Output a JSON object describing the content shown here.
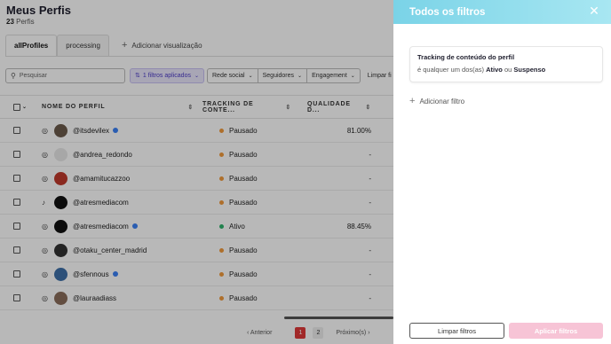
{
  "page": {
    "title": "Meus Perfis",
    "count": "23",
    "count_label": "Perfis"
  },
  "tabs": [
    {
      "label": "allProfiles",
      "active": true
    },
    {
      "label": "processing",
      "active": false
    }
  ],
  "add_view_label": "Adicionar visualização",
  "filters": {
    "search_placeholder": "Pesquisar",
    "applied_label": "1 filtros aplicados",
    "social_network_label": "Rede social",
    "followers_label": "Seguidores",
    "engagement_label": "Engagement",
    "clear_label": "Limpar fi"
  },
  "table": {
    "headers": {
      "name": "NOME DO PERFIL",
      "tracking": "TRACKING DE CONTE...",
      "quality": "QUALIDADE D..."
    },
    "rows": [
      {
        "network": "instagram",
        "handle": "@itsdevilex",
        "verified": true,
        "status": "Pausado",
        "quality": "81.00%",
        "avatar_color": "#6b5b4b"
      },
      {
        "network": "instagram",
        "handle": "@andrea_redondo",
        "verified": false,
        "status": "Pausado",
        "quality": "-",
        "avatar_color": "#e8e8e8"
      },
      {
        "network": "instagram",
        "handle": "@amamitucazzoo",
        "verified": false,
        "status": "Pausado",
        "quality": "-",
        "avatar_color": "#c0392b"
      },
      {
        "network": "tiktok",
        "handle": "@atresmediacom",
        "verified": false,
        "status": "Pausado",
        "quality": "-",
        "avatar_color": "#111111"
      },
      {
        "network": "instagram",
        "handle": "@atresmediacom",
        "verified": true,
        "status": "Ativo",
        "quality": "88.45%",
        "avatar_color": "#111111"
      },
      {
        "network": "instagram",
        "handle": "@otaku_center_madrid",
        "verified": false,
        "status": "Pausado",
        "quality": "-",
        "avatar_color": "#333333"
      },
      {
        "network": "instagram",
        "handle": "@sfennous",
        "verified": true,
        "status": "Pausado",
        "quality": "-",
        "avatar_color": "#3d6fa8"
      },
      {
        "network": "instagram",
        "handle": "@lauraadiass",
        "verified": false,
        "status": "Pausado",
        "quality": "-",
        "avatar_color": "#8a6d5a"
      }
    ]
  },
  "pagination": {
    "prev_label": "Anterior",
    "pages": [
      "1",
      "2"
    ],
    "current": "1",
    "next_label": "Próximo(s)"
  },
  "drawer": {
    "title": "Todos os filtros",
    "filter": {
      "title": "Tracking de conteúdo do perfil",
      "prefix": "é qualquer um dos(as)",
      "value1": "Ativo",
      "joiner": "ou",
      "value2": "Suspenso"
    },
    "add_filter_label": "Adicionar filtro",
    "clear_button": "Limpar filtros",
    "apply_button": "Aplicar filtros"
  },
  "colors": {
    "status_paused": "#f29a3c",
    "status_active": "#2fb36b",
    "header_gradient_start": "#7ad3e7",
    "apply_button_bg": "#f7c4d6"
  }
}
